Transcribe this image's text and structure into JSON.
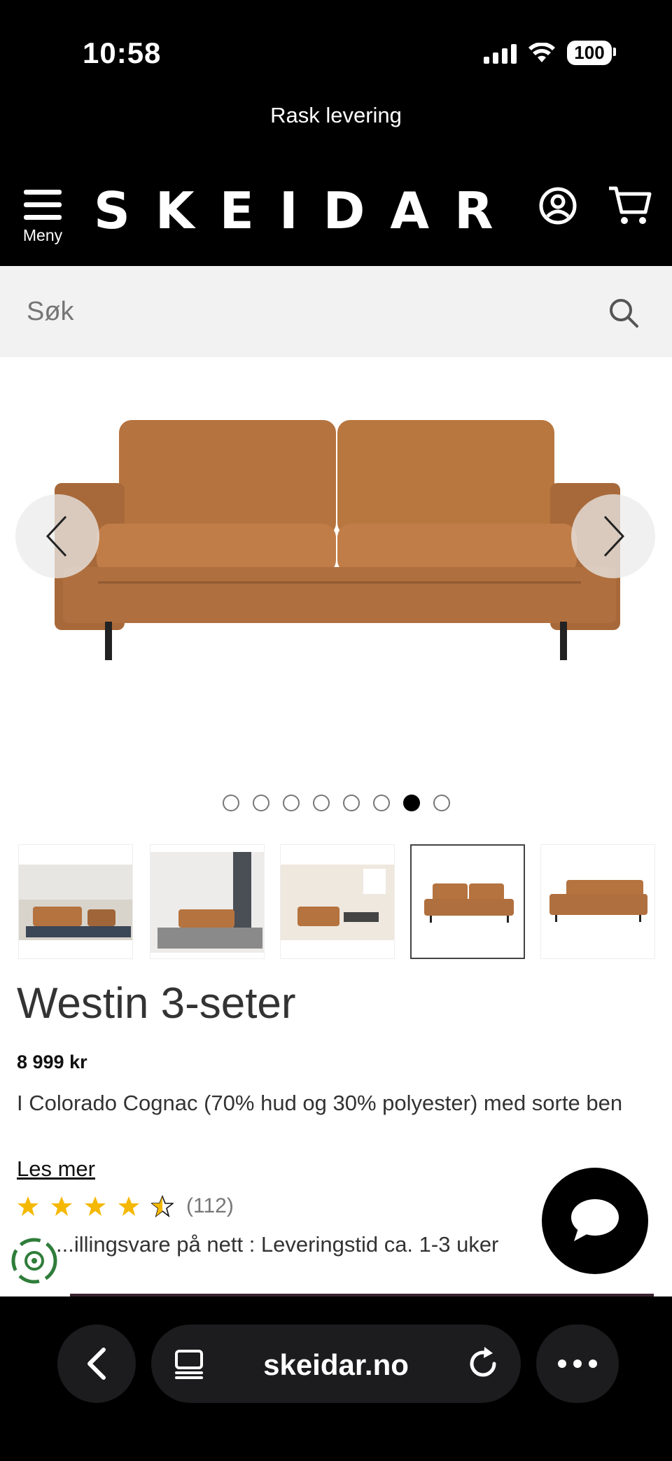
{
  "status_bar": {
    "time": "10:58",
    "battery": "100"
  },
  "promo": {
    "text": "Rask levering"
  },
  "header": {
    "menu_label": "Meny",
    "logo": "SKEIDAR"
  },
  "search": {
    "placeholder": "Søk"
  },
  "carousel": {
    "dot_count": 8,
    "active_dot_index": 6
  },
  "thumbnails": [
    {
      "name": "living-room-1"
    },
    {
      "name": "living-room-2"
    },
    {
      "name": "living-room-3"
    },
    {
      "name": "sofa-front",
      "selected": true
    },
    {
      "name": "sofa-angle"
    }
  ],
  "product": {
    "title": "Westin 3-seter",
    "price": "8 999 kr",
    "description": "I Colorado Cognac (70% hud og 30% polyester) med sorte ben",
    "read_more": "Les mer",
    "rating_value": 4.5,
    "rating_count": "(112)",
    "delivery": "...illingsvare på nett : Leveringstid ca. 1-3 uker"
  },
  "browser": {
    "url": "skeidar.no"
  },
  "colors": {
    "header_bg": "#000000",
    "search_bg": "#f2f2f2",
    "star": "#f5b800",
    "sofa": "#b87645"
  }
}
